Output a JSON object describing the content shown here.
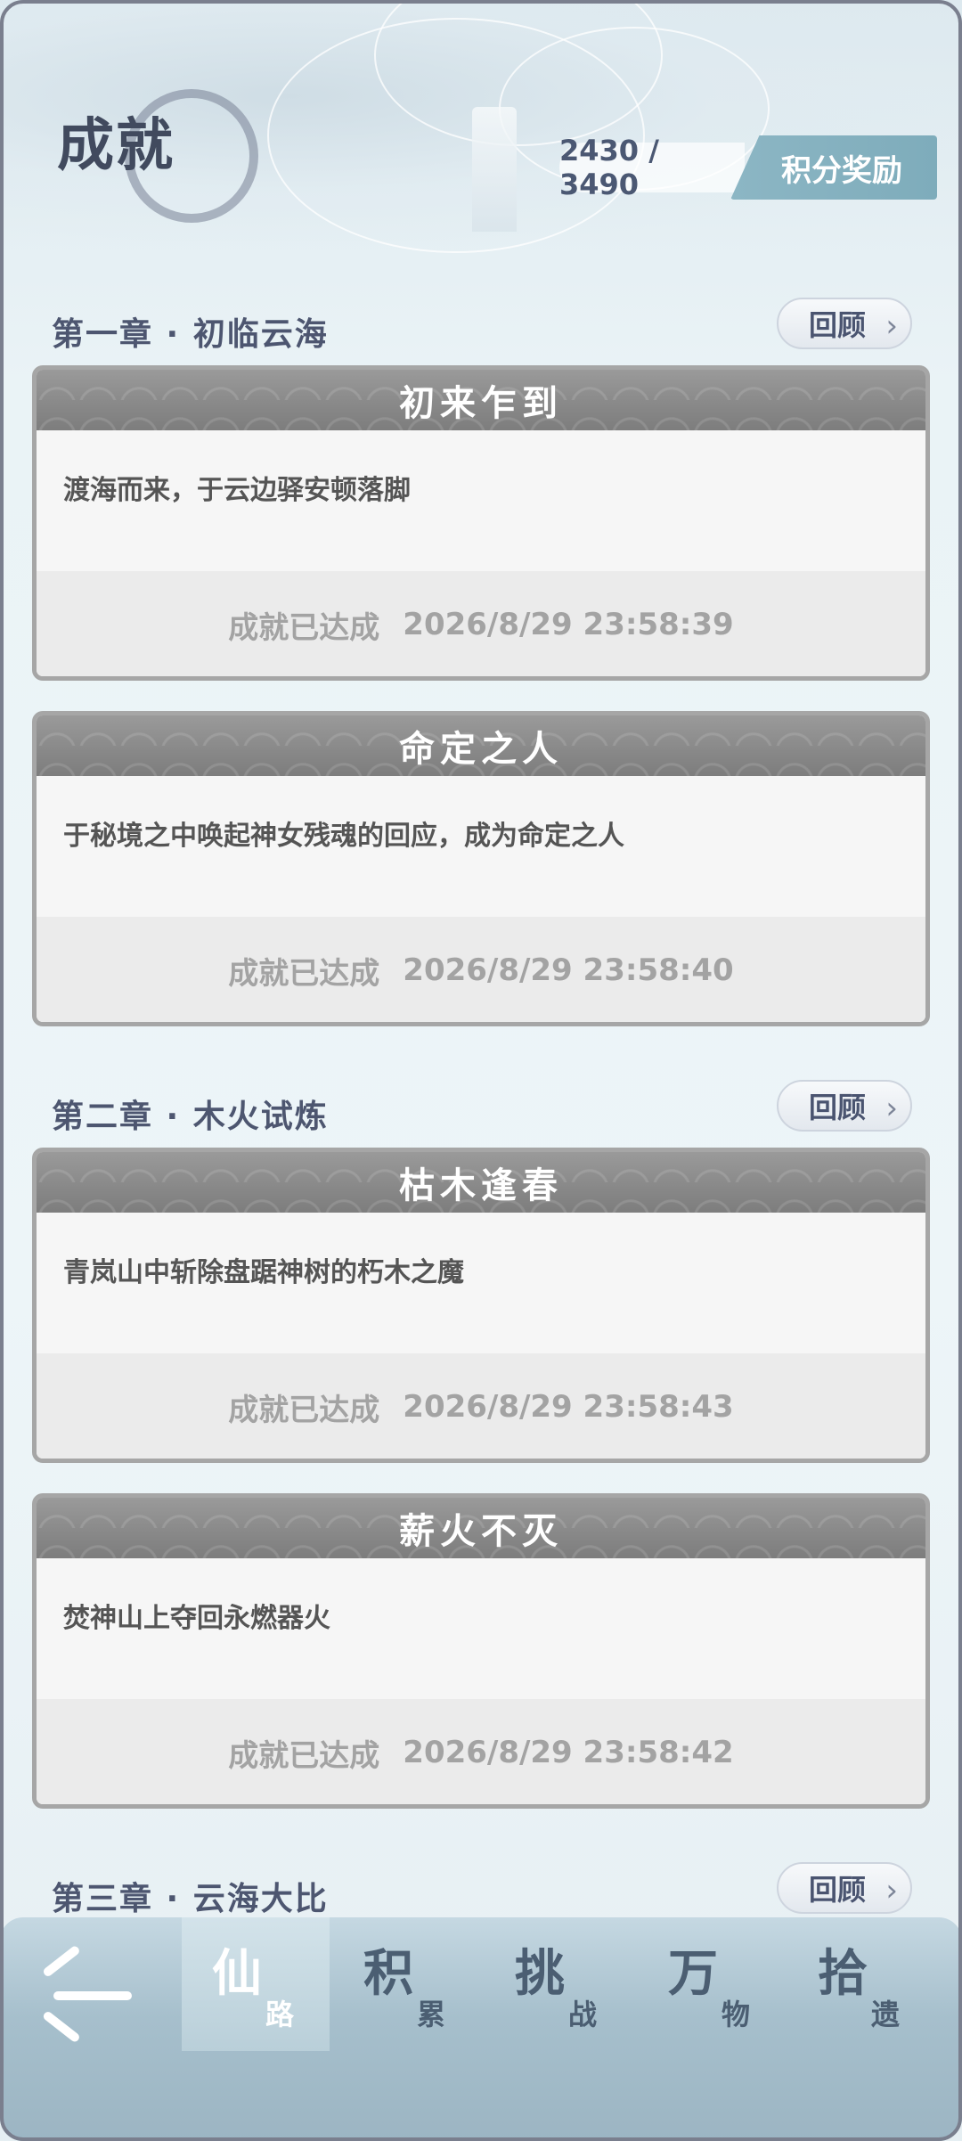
{
  "header": {
    "title": "成就",
    "score": "2430 / 3490",
    "reward_label": "积分奖励"
  },
  "chapters": [
    {
      "title": "第一章 · 初临云海",
      "review_label": "回顾",
      "cards": [
        {
          "title": "初来乍到",
          "desc": "渡海而来，于云边驿安顿落脚",
          "status": "成就已达成",
          "time": "2026/8/29 23:58:39"
        },
        {
          "title": "命定之人",
          "desc": "于秘境之中唤起神女残魂的回应，成为命定之人",
          "status": "成就已达成",
          "time": "2026/8/29 23:58:40"
        }
      ]
    },
    {
      "title": "第二章 · 木火试炼",
      "review_label": "回顾",
      "cards": [
        {
          "title": "枯木逢春",
          "desc": "青岚山中斩除盘踞神树的朽木之魔",
          "status": "成就已达成",
          "time": "2026/8/29 23:58:43"
        },
        {
          "title": "薪火不灭",
          "desc": "焚神山上夺回永燃器火",
          "status": "成就已达成",
          "time": "2026/8/29 23:58:42"
        }
      ]
    },
    {
      "title": "第三章 · 云海大比",
      "review_label": "回顾",
      "cards": []
    }
  ],
  "nav": {
    "back_icon": "back-arrow-icon",
    "tabs": [
      {
        "big": "仙",
        "small": "路"
      },
      {
        "big": "积",
        "small": "累"
      },
      {
        "big": "挑",
        "small": "战"
      },
      {
        "big": "万",
        "small": "物"
      },
      {
        "big": "拾",
        "small": "遗"
      }
    ]
  },
  "colors": {
    "accent": "#7eacbb",
    "card_header": "#888888",
    "nav_bg": "#a6bfcc"
  }
}
